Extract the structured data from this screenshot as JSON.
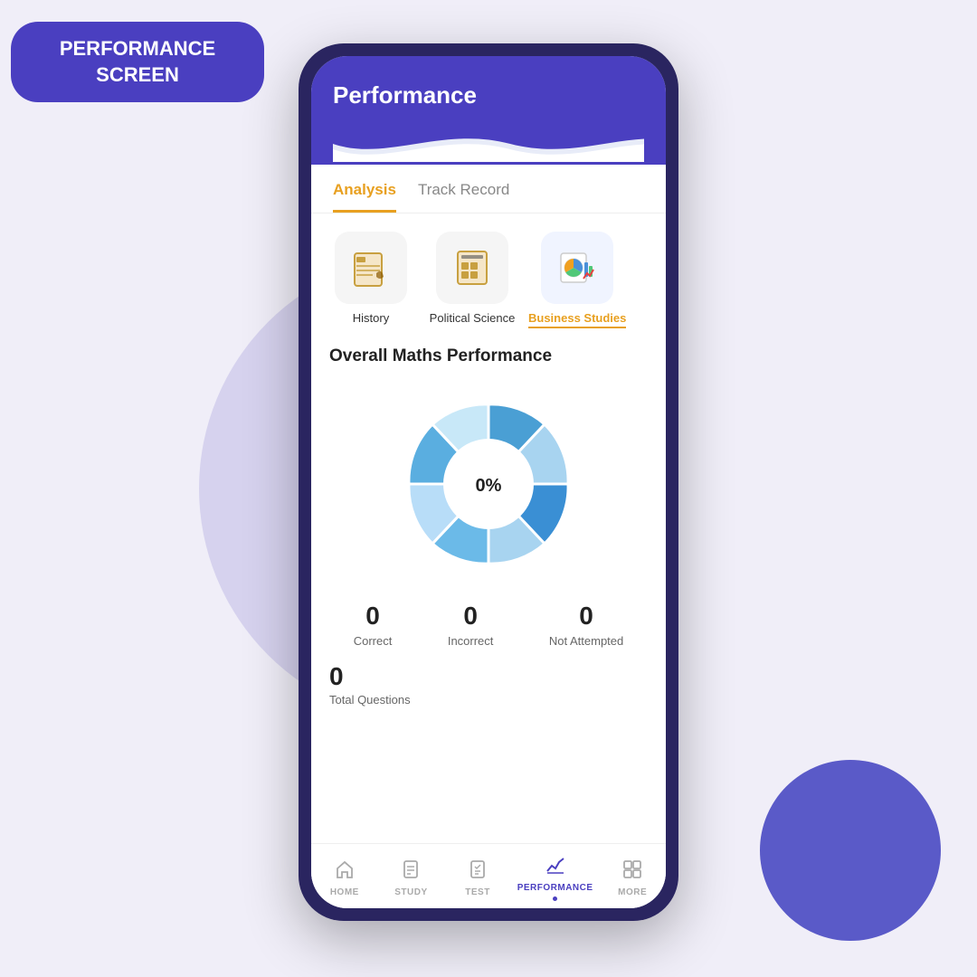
{
  "screen_label": "PERFORMANCE\nSCREEN",
  "phone": {
    "header_title": "Performance",
    "tabs": [
      {
        "id": "analysis",
        "label": "Analysis",
        "active": true
      },
      {
        "id": "track_record",
        "label": "Track Record",
        "active": false
      }
    ],
    "subjects": [
      {
        "id": "history",
        "label": "History",
        "active": false,
        "icon": "📜"
      },
      {
        "id": "political_science",
        "label": "Political Science",
        "active": false,
        "icon": "📕"
      },
      {
        "id": "business_studies",
        "label": "Business Studies",
        "active": true,
        "icon": "📊"
      }
    ],
    "section_title": "Overall Maths Performance",
    "chart": {
      "center_label": "0%",
      "segments": 8
    },
    "stats": [
      {
        "id": "correct",
        "value": "0",
        "label": "Correct"
      },
      {
        "id": "incorrect",
        "value": "0",
        "label": "Incorrect"
      },
      {
        "id": "not_attempted",
        "value": "0",
        "label": "Not Attempted"
      }
    ],
    "total": {
      "value": "0",
      "label": "Total Questions"
    },
    "bottom_nav": [
      {
        "id": "home",
        "label": "HOME",
        "active": false,
        "icon": "⌂"
      },
      {
        "id": "study",
        "label": "STUDY",
        "active": false,
        "icon": "📄"
      },
      {
        "id": "test",
        "label": "TEST",
        "active": false,
        "icon": "📋"
      },
      {
        "id": "performance",
        "label": "PERFORMANCE",
        "active": true,
        "icon": "📈"
      },
      {
        "id": "more",
        "label": "MORE",
        "active": false,
        "icon": "⊞"
      }
    ]
  },
  "colors": {
    "accent": "#4a3fc0",
    "active_tab": "#e8a020",
    "donut_dark": "#3a8fd4",
    "donut_light": "#a8d4f0"
  }
}
